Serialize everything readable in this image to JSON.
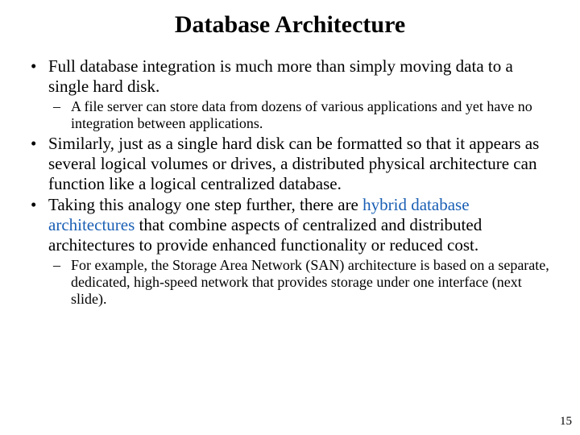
{
  "slide": {
    "title": "Database Architecture",
    "bullets": [
      {
        "text": "Full database integration is much more than simply moving data to a single hard disk.",
        "sub": [
          "A file server can store data from dozens of various applications and yet have no integration between applications."
        ]
      },
      {
        "text": "Similarly, just as a single hard disk can be formatted so that it appears as several logical volumes or drives, a distributed physical architecture can function like a logical centralized database."
      },
      {
        "pre": "Taking this analogy one step further, there are ",
        "hl": "hybrid database architectures",
        "post": " that combine aspects of centralized and distributed architectures to provide enhanced functionality or reduced cost.",
        "sub": [
          "For example, the Storage Area Network (SAN) architecture is based on a separate, dedicated, high-speed network that provides storage under one interface (next slide)."
        ]
      }
    ],
    "page_number": "15"
  }
}
